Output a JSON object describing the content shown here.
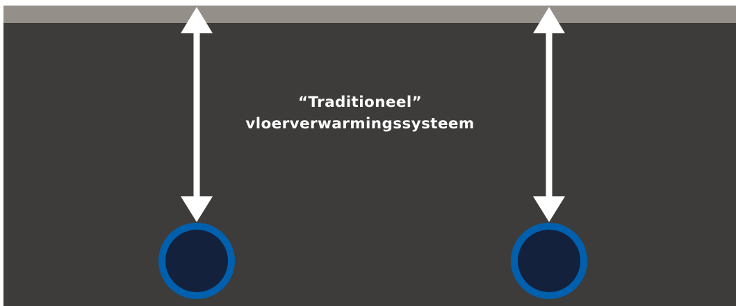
{
  "label": {
    "line1": "“Traditioneel”",
    "line2": "vloerverwarmingssysteem"
  },
  "colors": {
    "floor_surface": "#958f89",
    "screed": "#3d3c3a",
    "arrow": "#ffffff",
    "pipe_ring": "#0060ad",
    "pipe_core": "#13213d",
    "text": "#ffffff"
  },
  "pipes": {
    "count": 2
  }
}
